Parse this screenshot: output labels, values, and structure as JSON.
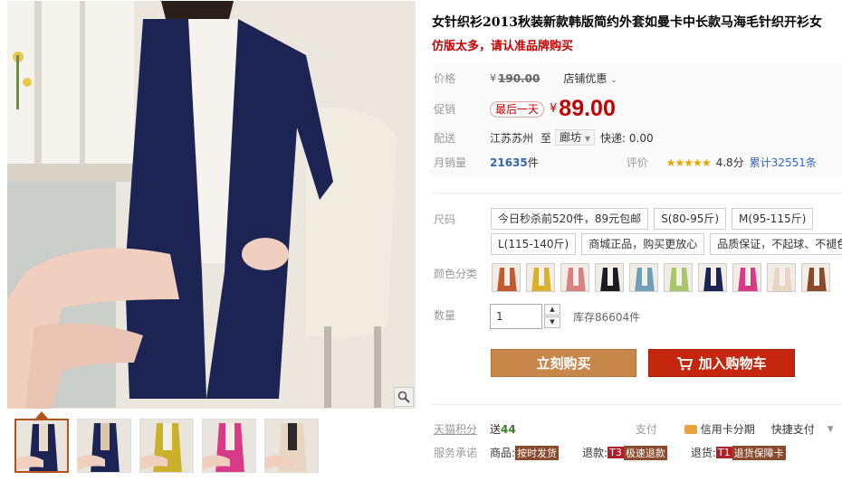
{
  "product": {
    "title": "女针织衫2013秋装新款韩版简约外套如曼卡中长款马海毛针织开衫女",
    "subtitle": "仿版太多，请认准品牌购买"
  },
  "price": {
    "label": "价格",
    "currency": "¥",
    "original": "190.00",
    "shop_promo": "店铺优惠"
  },
  "promo": {
    "label": "促销",
    "tag": "最后一天",
    "currency": "¥",
    "price": "89.00"
  },
  "shipping": {
    "label": "配送",
    "from": "江苏苏州",
    "to_word": "至",
    "destination": "廊坊",
    "express": "快递: 0.00"
  },
  "sales": {
    "label": "月销量",
    "count": "21635",
    "unit": "件",
    "rating_label": "评价",
    "stars": "★★★★★",
    "score": "4.8分",
    "total": "累计32551条"
  },
  "sizes": {
    "label": "尺码",
    "options": [
      "今日秒杀前520件，89元包邮",
      "S(80-95斤)",
      "M(95-115斤)",
      "L(115-140斤)",
      "商城正品，购买更放心",
      "品质保证，不起球、不褪色"
    ]
  },
  "colors": {
    "label": "颜色分类",
    "swatches": [
      "#c45a2e",
      "#d9b12a",
      "#d98080",
      "#1b1b22",
      "#6fa0b8",
      "#a8c66a",
      "#1b2452",
      "#d83a86",
      "#e8d6c3",
      "#8a4a2e"
    ]
  },
  "quantity": {
    "label": "数量",
    "value": "1",
    "stock": "库存86604件"
  },
  "actions": {
    "buy": "立刻购买",
    "cart": "加入购物车"
  },
  "footer": {
    "points_label": "天猫积分",
    "points_send": "送",
    "points_value": "44",
    "pay_label": "支付",
    "credit": "信用卡分期",
    "quick_pay": "快捷支付",
    "service_label": "服务承诺",
    "goods_label": "商品:",
    "goods_tag": "按时发货",
    "refund_label": "退款:",
    "refund_code": "T3",
    "refund_tag": "极速退款",
    "return_label": "退货:",
    "return_code": "T1",
    "return_tag": "退货保障卡"
  },
  "thumbnails": [
    {
      "bg": "#1b2452",
      "accent": "#e8dcc8"
    },
    {
      "bg": "#1b2452",
      "accent": "#d8c8b0"
    },
    {
      "bg": "#c9b22a",
      "accent": "#f2efe8"
    },
    {
      "bg": "#d83a86",
      "accent": "#f2efe8"
    },
    {
      "bg": "#e8d6c3",
      "accent": "#2a2a2a"
    }
  ]
}
